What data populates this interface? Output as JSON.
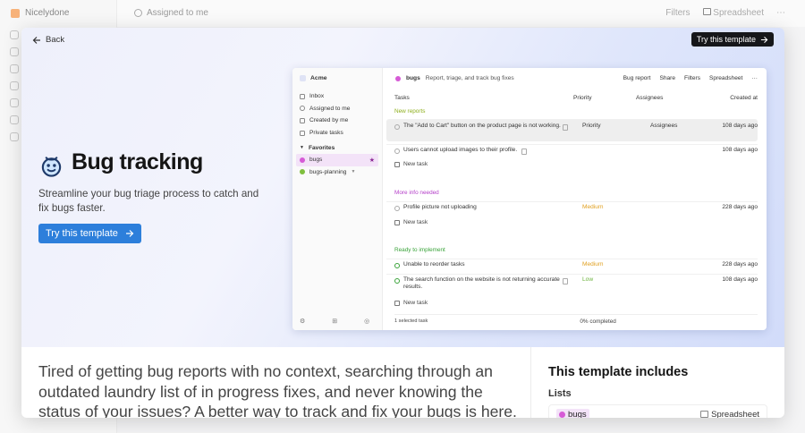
{
  "app": {
    "workspace_name": "Nicelydone",
    "view_name": "Assigned to me",
    "filters_label": "Filters",
    "spreadsheet_label": "Spreadsheet"
  },
  "modal": {
    "back_label": "Back",
    "try_top_label": "Try this template",
    "hero_title": "Bug tracking",
    "hero_subtitle": "Streamline your bug triage process to catch and fix bugs faster.",
    "try_main_label": "Try this template",
    "body_text": "Tired of getting bug reports with no context, searching through an outdated laundry list of in progress fixes, and never knowing the status of your issues? A better way to track and fix your bugs is here.",
    "includes_title": "This template includes",
    "lists_label": "Lists",
    "list_card": {
      "name": "bugs",
      "view": "Spreadsheet"
    }
  },
  "preview": {
    "workspace": "Acme",
    "nav": [
      "Inbox",
      "Assigned to me",
      "Created by me",
      "Private tasks"
    ],
    "favorites_label": "Favorites",
    "favorites": [
      "bugs",
      "bugs-planning"
    ],
    "list_title": "bugs",
    "list_desc": "Report, triage, and track bug fixes",
    "actions": [
      "Bug report",
      "Share",
      "Filters",
      "Spreadsheet",
      "···"
    ],
    "columns": {
      "task": "Tasks",
      "priority": "Priority",
      "assignees": "Assignees",
      "created": "Created at"
    },
    "groups": [
      {
        "name": "New reports",
        "color": "#8cae1a",
        "rows": [
          {
            "text": "The \"Add to Cart\" button on the product page is not working.",
            "priority": "Priority",
            "assignees": "Assignees",
            "created": "108 days ago"
          },
          {
            "text": "Users cannot upload images to their profile.",
            "priority": "",
            "assignees": "",
            "created": "108 days ago"
          }
        ]
      },
      {
        "name": "More info needed",
        "color": "#b43ec9",
        "rows": [
          {
            "text": "Profile picture not uploading",
            "priority": "Medium",
            "assignees": "",
            "created": "228 days ago"
          }
        ]
      },
      {
        "name": "Ready to implement",
        "color": "#3aa33a",
        "rows": [
          {
            "text": "Unable to reorder tasks",
            "priority": "Medium",
            "assignees": "",
            "created": "228 days ago"
          },
          {
            "text": "The search function on the website is not returning accurate results.",
            "priority": "Low",
            "assignees": "",
            "created": "108 days ago"
          }
        ]
      }
    ],
    "new_task_label": "New task",
    "selected_label": "1 selected task",
    "completed_label": "0% completed",
    "priority_colors": {
      "Medium": "#e0a020",
      "Low": "#6cb33e",
      "Priority": "#555555"
    }
  }
}
